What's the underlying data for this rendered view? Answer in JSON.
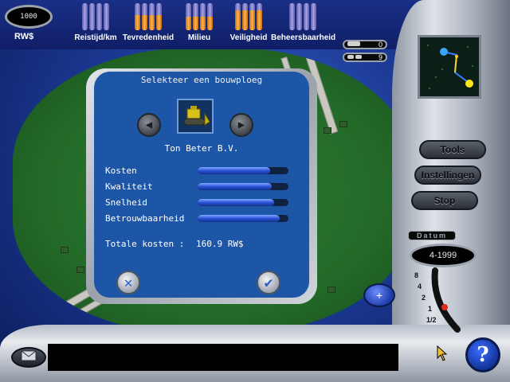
{
  "top": {
    "money": "1000",
    "currency": "RW$",
    "meters": [
      {
        "label": "Reistijd/km",
        "levels": [
          0,
          0,
          0,
          0
        ]
      },
      {
        "label": "Tevredenheid",
        "levels": [
          0.55,
          0.55,
          0.55,
          0.55
        ]
      },
      {
        "label": "Milieu",
        "levels": [
          0.5,
          0.5,
          0.5,
          0.5
        ]
      },
      {
        "label": "Veiligheid",
        "levels": [
          0.75,
          0.75,
          0.75,
          0.75
        ]
      },
      {
        "label": "Beheersbaarheid",
        "levels": [
          0,
          0,
          0,
          0
        ]
      }
    ],
    "counters": [
      {
        "icon": "train-icon",
        "value": "0"
      },
      {
        "icon": "cars-icon",
        "value": "9"
      }
    ]
  },
  "side": {
    "buttons": [
      "Tools",
      "Instellingen",
      "Stop"
    ],
    "date_label": "Datum",
    "date_value": "4-1999",
    "speeds": [
      "8",
      "4",
      "2",
      "1",
      "1/2"
    ],
    "current_speed": "1"
  },
  "dialog": {
    "title": "Selekteer een bouwploeg",
    "company": "Ton Beter B.V.",
    "prev_icon": "arrow-left-icon",
    "next_icon": "arrow-right-icon",
    "image_icon": "bulldozer-icon",
    "stats": [
      {
        "name": "Kosten",
        "level": 0.8
      },
      {
        "name": "Kwaliteit",
        "level": 0.82
      },
      {
        "name": "Snelheid",
        "level": 0.84
      },
      {
        "name": "Betrouwbaarheid",
        "level": 0.9
      }
    ],
    "total_label": "Totale kosten :",
    "total_value": "160.9  RW$"
  },
  "colors": {
    "dialog_bg": "#1d56a6",
    "bar_fill": "#2a52d8",
    "meter_fill": "#ffb44a",
    "field_green": "#2f7a32"
  }
}
